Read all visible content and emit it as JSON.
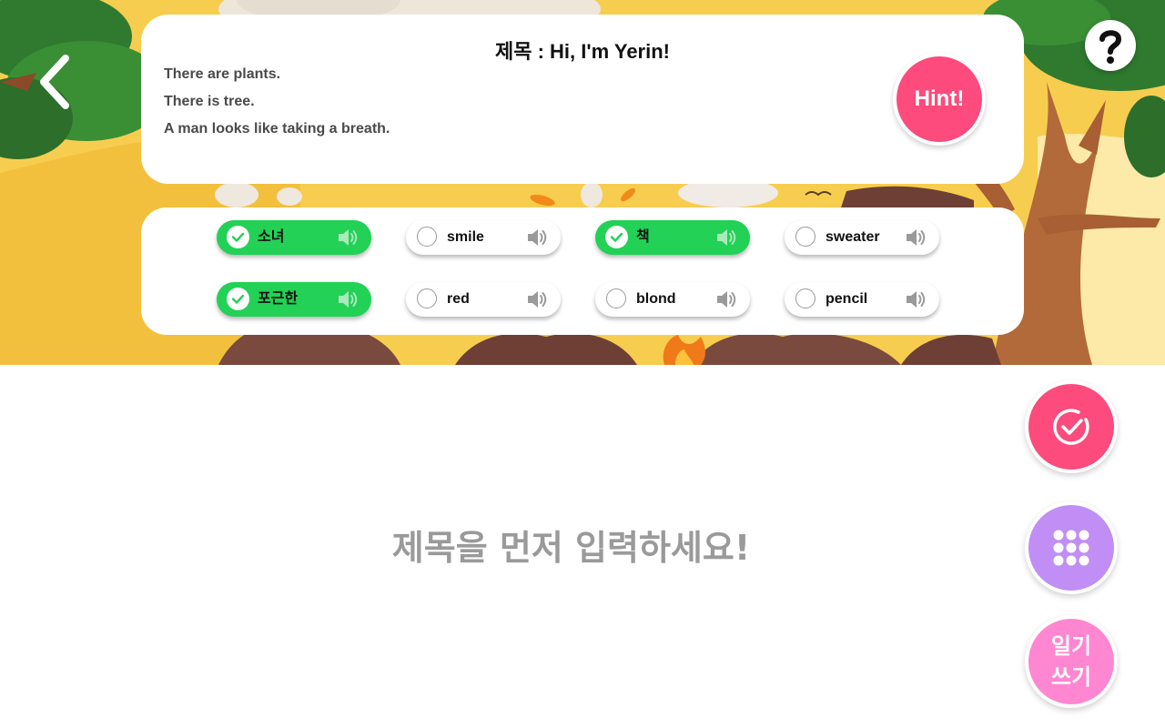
{
  "header": {
    "title": "제목 : Hi, I'm Yerin!",
    "sentences": [
      "There are plants.",
      "There is tree.",
      "A man looks like taking a breath."
    ],
    "hint_label": "Hint!"
  },
  "words": [
    {
      "label": "소녀",
      "selected": true
    },
    {
      "label": "smile",
      "selected": false
    },
    {
      "label": "책",
      "selected": true
    },
    {
      "label": "sweater",
      "selected": false
    },
    {
      "label": "포근한",
      "selected": true
    },
    {
      "label": "red",
      "selected": false
    },
    {
      "label": "blond",
      "selected": false
    },
    {
      "label": "pencil",
      "selected": false
    }
  ],
  "main": {
    "placeholder": "제목을 먼저 입력하세요!"
  },
  "actions": {
    "diary_line1": "일기",
    "diary_line2": "쓰기"
  },
  "colors": {
    "accent_pink": "#fc4b7c",
    "selected_green": "#22d156",
    "grid_purple": "#c08ef5",
    "diary_pink": "#ff86d1",
    "scene_yellow": "#f6c84a"
  },
  "icons": {
    "back": "chevron-left-icon",
    "help": "question-mark-icon",
    "speaker": "speaker-icon",
    "check": "check-circle-icon",
    "grid": "grid-dots-icon"
  }
}
